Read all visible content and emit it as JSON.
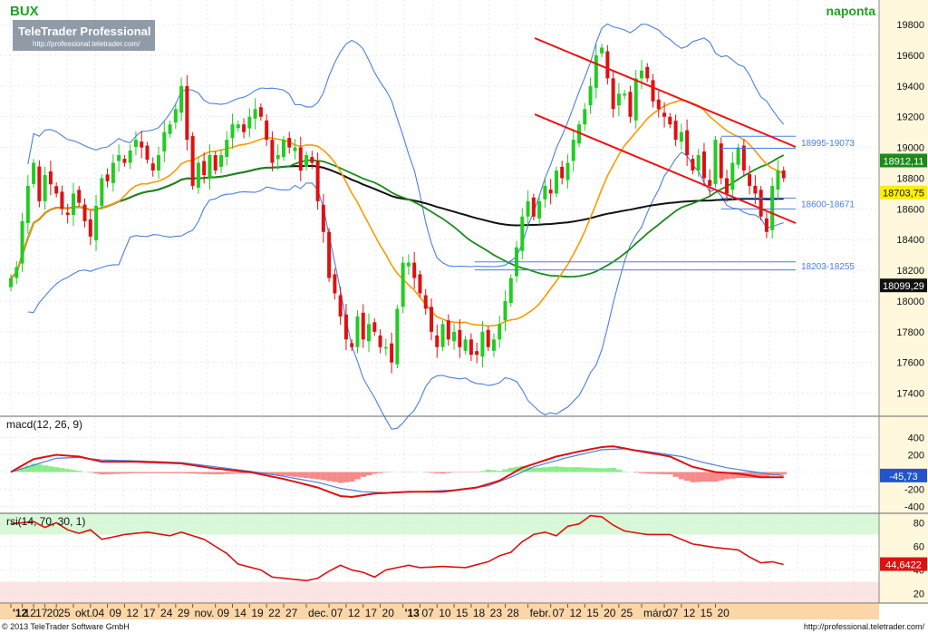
{
  "header": {
    "instrument": "BUX",
    "period": "naponta",
    "logo_title": "TeleTrader Professional",
    "logo_url": "http://professional.teletrader.com/"
  },
  "footer": {
    "copyright": "© 2013 TeleTrader Software GmbH",
    "url": "http://professional.teletrader.com/"
  },
  "colors": {
    "title_green": "#1fa31f",
    "candle_up": "#22cc22",
    "candle_down": "#dd1111",
    "sma_short": "#ff9900",
    "sma_mid": "#1a8a1a",
    "sma_long": "#111111",
    "bollinger": "#4a7fe0",
    "channel": "#ee1111",
    "macd_line": "#dd1111",
    "signal_line": "#4a7fe0",
    "hist_pos": "#88ee88",
    "hist_neg": "#f58a8a",
    "rsi_line": "#dd1111",
    "rsi_band": "#c8f5c8",
    "axis_bg": "#fff8dd",
    "date_bg": "#fdd6a8"
  },
  "chart_data": [
    {
      "id": "price",
      "type": "candlestick",
      "title": "BUX",
      "ylim": [
        17250,
        19960
      ],
      "yticks": [
        17400,
        17600,
        17800,
        18000,
        18200,
        18400,
        18600,
        18800,
        19000,
        19200,
        19400,
        19600,
        19800
      ],
      "ytick_labels": [
        "17400",
        "17600",
        "17800",
        "18000",
        "18200",
        "18400",
        "18600",
        "18800",
        "19000",
        "19200",
        "19400",
        "19600",
        "19800"
      ],
      "last_value_labels": [
        {
          "label": "18912,11",
          "value": 18912,
          "bg": "#1a8a1a",
          "color": "#ffffff"
        },
        {
          "label": "18703,75",
          "value": 18704,
          "bg": "#ffee00",
          "color": "#111111"
        },
        {
          "label": "18099,29",
          "value": 18099,
          "bg": "#111111",
          "color": "#ffffff"
        }
      ],
      "support_resistance": [
        {
          "label": "18995-19073",
          "low": 18995,
          "high": 19073
        },
        {
          "label": "18600-18671",
          "low": 18600,
          "high": 18671
        },
        {
          "label": "18203-18255",
          "low": 18203,
          "high": 18255
        }
      ],
      "closes": [
        18150,
        18220,
        18520,
        18750,
        18900,
        18650,
        18820,
        18760,
        18700,
        18600,
        18560,
        18700,
        18640,
        18520,
        18420,
        18620,
        18800,
        18780,
        18900,
        18950,
        18900,
        18980,
        19050,
        19000,
        18920,
        18850,
        18950,
        19100,
        19150,
        19250,
        19400,
        19050,
        18750,
        18900,
        18820,
        18950,
        18850,
        18950,
        19050,
        19150,
        19150,
        19100,
        19200,
        19250,
        19200,
        19050,
        18900,
        18950,
        19050,
        19000,
        19000,
        18850,
        18950,
        18900,
        18650,
        18450,
        18150,
        18050,
        17900,
        17750,
        17700,
        17900,
        17750,
        17850,
        17800,
        17700,
        17700,
        17600,
        17950,
        18250,
        18250,
        18150,
        18050,
        17950,
        17800,
        17700,
        17850,
        17750,
        17800,
        17700,
        17750,
        17650,
        17650,
        17800,
        17700,
        17750,
        17850,
        18000,
        18150,
        18350,
        18550,
        18650,
        18550,
        18650,
        18750,
        18700,
        18850,
        18800,
        18900,
        19050,
        19150,
        19250,
        19400,
        19600,
        19650,
        19450,
        19250,
        19350,
        19350,
        19200,
        19450,
        19500,
        19450,
        19300,
        19250,
        19200,
        19150,
        19050,
        19100,
        18950,
        18850,
        18950,
        18800,
        18750,
        19050,
        18800,
        18700,
        18900,
        19000,
        18850,
        18750,
        18700,
        18550,
        18450,
        18750,
        18850,
        18800
      ]
    },
    {
      "id": "macd",
      "type": "line",
      "title": "macd(12, 26, 9)",
      "ylim": [
        -480,
        480
      ],
      "yticks": [
        -400,
        -200,
        0,
        200,
        400
      ],
      "ytick_labels": [
        "-400",
        "-200",
        "0",
        "200",
        "400"
      ],
      "last_value_label": {
        "label": "-45,73",
        "value": -46
      },
      "macd_anchors": [
        [
          0,
          0
        ],
        [
          4,
          150
        ],
        [
          8,
          200
        ],
        [
          12,
          180
        ],
        [
          16,
          120
        ],
        [
          22,
          120
        ],
        [
          30,
          100
        ],
        [
          36,
          40
        ],
        [
          42,
          0
        ],
        [
          48,
          -80
        ],
        [
          54,
          -180
        ],
        [
          58,
          -280
        ],
        [
          60,
          -290
        ],
        [
          64,
          -250
        ],
        [
          70,
          -230
        ],
        [
          76,
          -230
        ],
        [
          82,
          -180
        ],
        [
          86,
          -100
        ],
        [
          90,
          50
        ],
        [
          96,
          180
        ],
        [
          100,
          240
        ],
        [
          104,
          290
        ],
        [
          106,
          300
        ],
        [
          110,
          250
        ],
        [
          116,
          180
        ],
        [
          120,
          60
        ],
        [
          124,
          0
        ],
        [
          128,
          -20
        ],
        [
          132,
          -60
        ],
        [
          136,
          -60
        ]
      ],
      "signal_anchors": [
        [
          0,
          0
        ],
        [
          4,
          80
        ],
        [
          8,
          160
        ],
        [
          12,
          170
        ],
        [
          16,
          140
        ],
        [
          22,
          130
        ],
        [
          30,
          110
        ],
        [
          36,
          60
        ],
        [
          42,
          10
        ],
        [
          48,
          -50
        ],
        [
          54,
          -120
        ],
        [
          58,
          -190
        ],
        [
          62,
          -230
        ],
        [
          66,
          -240
        ],
        [
          72,
          -230
        ],
        [
          78,
          -210
        ],
        [
          84,
          -160
        ],
        [
          88,
          -60
        ],
        [
          92,
          60
        ],
        [
          98,
          170
        ],
        [
          104,
          260
        ],
        [
          108,
          270
        ],
        [
          112,
          240
        ],
        [
          118,
          180
        ],
        [
          122,
          110
        ],
        [
          126,
          50
        ],
        [
          130,
          10
        ],
        [
          134,
          -30
        ],
        [
          136,
          -40
        ]
      ]
    },
    {
      "id": "rsi",
      "type": "line",
      "title": "rsi(14, 70, 30, 1)",
      "ylim": [
        12,
        88
      ],
      "yticks": [
        20,
        40,
        60,
        80
      ],
      "ytick_labels": [
        "20",
        "40",
        "60",
        "80"
      ],
      "overbought": 70,
      "oversold": 30,
      "last_value_label": {
        "label": "44,6422",
        "value": 44.6
      },
      "anchors": [
        [
          0,
          79
        ],
        [
          4,
          81
        ],
        [
          6,
          76
        ],
        [
          8,
          80
        ],
        [
          10,
          74
        ],
        [
          12,
          71
        ],
        [
          14,
          74
        ],
        [
          16,
          66
        ],
        [
          20,
          70
        ],
        [
          24,
          72
        ],
        [
          28,
          69
        ],
        [
          30,
          72
        ],
        [
          34,
          66
        ],
        [
          38,
          54
        ],
        [
          40,
          45
        ],
        [
          44,
          40
        ],
        [
          46,
          34
        ],
        [
          48,
          33
        ],
        [
          50,
          32
        ],
        [
          52,
          31
        ],
        [
          54,
          33
        ],
        [
          56,
          39
        ],
        [
          58,
          44
        ],
        [
          60,
          40
        ],
        [
          62,
          38
        ],
        [
          64,
          34
        ],
        [
          66,
          40
        ],
        [
          70,
          44
        ],
        [
          72,
          42
        ],
        [
          76,
          43
        ],
        [
          80,
          42
        ],
        [
          84,
          47
        ],
        [
          86,
          52
        ],
        [
          88,
          55
        ],
        [
          90,
          64
        ],
        [
          92,
          70
        ],
        [
          94,
          72
        ],
        [
          96,
          69
        ],
        [
          98,
          77
        ],
        [
          100,
          79
        ],
        [
          102,
          86
        ],
        [
          104,
          85
        ],
        [
          106,
          78
        ],
        [
          108,
          73
        ],
        [
          112,
          70
        ],
        [
          116,
          70
        ],
        [
          120,
          62
        ],
        [
          124,
          59
        ],
        [
          128,
          57
        ],
        [
          130,
          51
        ],
        [
          132,
          46
        ],
        [
          134,
          47
        ],
        [
          136,
          44.6
        ]
      ]
    }
  ],
  "x_axis": {
    "labels": [
      {
        "i": 0,
        "text": "'12",
        "bold": true
      },
      {
        "i": 2,
        "text": "12"
      },
      {
        "i": 4,
        "text": "17"
      },
      {
        "i": 6,
        "text": "20"
      },
      {
        "i": 8,
        "text": "25"
      },
      {
        "i": 11,
        "text": "okt."
      },
      {
        "i": 14,
        "text": "04"
      },
      {
        "i": 17,
        "text": "09"
      },
      {
        "i": 20,
        "text": "12"
      },
      {
        "i": 23,
        "text": "17"
      },
      {
        "i": 26,
        "text": "24"
      },
      {
        "i": 29,
        "text": "29"
      },
      {
        "i": 32,
        "text": "nov."
      },
      {
        "i": 36,
        "text": "09"
      },
      {
        "i": 39,
        "text": "14"
      },
      {
        "i": 42,
        "text": "19"
      },
      {
        "i": 45,
        "text": "22"
      },
      {
        "i": 48,
        "text": "27"
      },
      {
        "i": 52,
        "text": "dec."
      },
      {
        "i": 56,
        "text": "07"
      },
      {
        "i": 59,
        "text": "12"
      },
      {
        "i": 62,
        "text": "17"
      },
      {
        "i": 65,
        "text": "20"
      },
      {
        "i": 69,
        "text": "'13",
        "bold": true
      },
      {
        "i": 72,
        "text": "07"
      },
      {
        "i": 75,
        "text": "10"
      },
      {
        "i": 78,
        "text": "15"
      },
      {
        "i": 81,
        "text": "18"
      },
      {
        "i": 84,
        "text": "23"
      },
      {
        "i": 87,
        "text": "28"
      },
      {
        "i": 91,
        "text": "febr."
      },
      {
        "i": 95,
        "text": "07"
      },
      {
        "i": 98,
        "text": "12"
      },
      {
        "i": 101,
        "text": "15"
      },
      {
        "i": 104,
        "text": "20"
      },
      {
        "i": 107,
        "text": "25"
      },
      {
        "i": 111,
        "text": "márc."
      },
      {
        "i": 115,
        "text": "07"
      },
      {
        "i": 118,
        "text": "12"
      },
      {
        "i": 121,
        "text": "15"
      },
      {
        "i": 124,
        "text": "20"
      }
    ]
  }
}
